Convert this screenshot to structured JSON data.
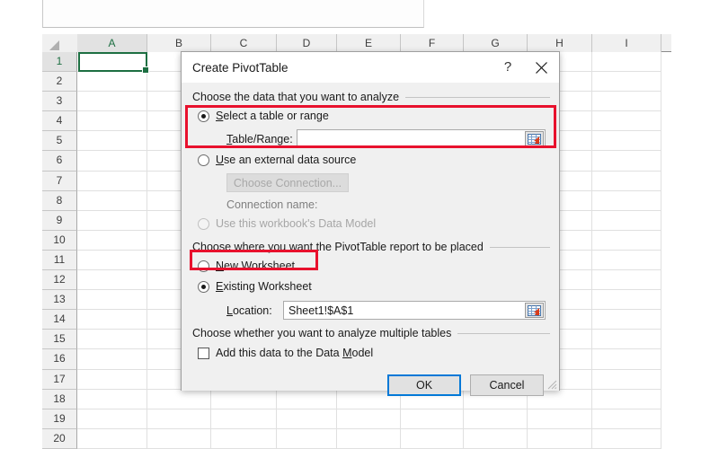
{
  "spreadsheet": {
    "columns": [
      "A",
      "B",
      "C",
      "D",
      "E",
      "F",
      "G",
      "H",
      "I"
    ],
    "rows": [
      "1",
      "2",
      "3",
      "4",
      "5",
      "6",
      "7",
      "8",
      "9",
      "10",
      "11",
      "12",
      "13",
      "14",
      "15",
      "16",
      "17",
      "18",
      "19",
      "20"
    ],
    "selected_cell": "A1",
    "selected_column": "A",
    "selected_row": "1",
    "corner_icon": "select-all-triangle-icon"
  },
  "dialog": {
    "title": "Create PivotTable",
    "help_label": "?",
    "close_icon": "close-icon",
    "resize_grip_icon": "resize-grip-icon",
    "section_data": {
      "header": "Choose the data that you want to analyze",
      "option_range": {
        "label_prefix": "S",
        "label_rest": "elect a table or range",
        "selected": true
      },
      "table_range": {
        "label_prefix": "T",
        "label_rest": "able/Range:",
        "value": "",
        "picker_icon": "range-picker-icon"
      },
      "option_external": {
        "label_prefix": "U",
        "label_rest": "se an external data source",
        "selected": false
      },
      "choose_connection_label": "Choose Connection...",
      "connection_name_label": "Connection name:",
      "option_data_model": {
        "label": "Use this workbook's Data Model",
        "selected": false,
        "disabled": true
      }
    },
    "section_placement": {
      "header": "Choose where you want the PivotTable report to be placed",
      "option_new": {
        "label_prefix": "N",
        "label_rest": "ew Worksheet",
        "selected": false
      },
      "option_existing": {
        "label_prefix": "E",
        "label_rest": "xisting Worksheet",
        "selected": true
      },
      "location": {
        "label_prefix": "L",
        "label_rest": "ocation:",
        "value": "Sheet1!$A$1",
        "picker_icon": "range-picker-icon"
      }
    },
    "section_multiple": {
      "header": "Choose whether you want to analyze multiple tables",
      "checkbox": {
        "label_before": "Add this data to the Data ",
        "label_mnemonic": "M",
        "label_after": "odel",
        "checked": false
      }
    },
    "buttons": {
      "ok": "OK",
      "cancel": "Cancel"
    }
  },
  "annotations": {
    "accent_color": "#e8112d",
    "boxes": [
      "select-a-table-or-range-highlight",
      "new-worksheet-highlight"
    ]
  }
}
